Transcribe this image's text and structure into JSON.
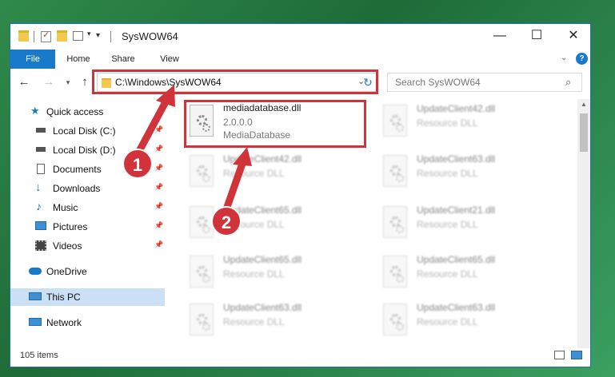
{
  "window": {
    "title": "SysWOW64",
    "controls": {
      "minimize": "—",
      "maximize": "☐",
      "close": "✕"
    }
  },
  "ribbon": {
    "tabs": [
      "File",
      "Home",
      "Share",
      "View"
    ],
    "accent": "#1979ca"
  },
  "address": {
    "path": "C:\\Windows\\SysWOW64",
    "search_placeholder": "Search SysWOW64"
  },
  "sidebar": {
    "items": [
      {
        "label": "Quick access",
        "icon": "star-icon",
        "pinned": false
      },
      {
        "label": "Local Disk (C:)",
        "icon": "drive-icon",
        "pinned": true
      },
      {
        "label": "Local Disk (D:)",
        "icon": "drive-icon",
        "pinned": true
      },
      {
        "label": "Documents",
        "icon": "documents-icon",
        "pinned": true
      },
      {
        "label": "Downloads",
        "icon": "download-icon",
        "pinned": true
      },
      {
        "label": "Music",
        "icon": "music-icon",
        "pinned": true
      },
      {
        "label": "Pictures",
        "icon": "pictures-icon",
        "pinned": true
      },
      {
        "label": "Videos",
        "icon": "videos-icon",
        "pinned": true
      },
      {
        "label": "OneDrive",
        "icon": "cloud-icon",
        "pinned": false
      },
      {
        "label": "This PC",
        "icon": "computer-icon",
        "pinned": false
      },
      {
        "label": "Network",
        "icon": "network-icon",
        "pinned": false
      }
    ]
  },
  "files": [
    {
      "name": "mediadatabase.dll",
      "version": "2.0.0.0",
      "description": "MediaDatabase"
    },
    {
      "name": "UpdateClient42.dll",
      "description": "Resource DLL"
    },
    {
      "name": "UpdateClient42.dll",
      "description": "Resource DLL"
    },
    {
      "name": "UpdateClient63.dll",
      "description": "Resource DLL"
    },
    {
      "name": "UpdateClient65.dll",
      "description": "Resource DLL"
    },
    {
      "name": "UpdateClient21.dll",
      "description": "Resource DLL"
    },
    {
      "name": "UpdateClient65.dll",
      "description": "Resource DLL"
    },
    {
      "name": "UpdateClient65.dll",
      "description": "Resource DLL"
    },
    {
      "name": "UpdateClient63.dll",
      "description": "Resource DLL"
    },
    {
      "name": "UpdateClient63.dll",
      "description": "Resource DLL"
    }
  ],
  "status": {
    "count": "105 items"
  },
  "annotations": {
    "step1": "1",
    "step2": "2",
    "color": "#d0343a"
  }
}
